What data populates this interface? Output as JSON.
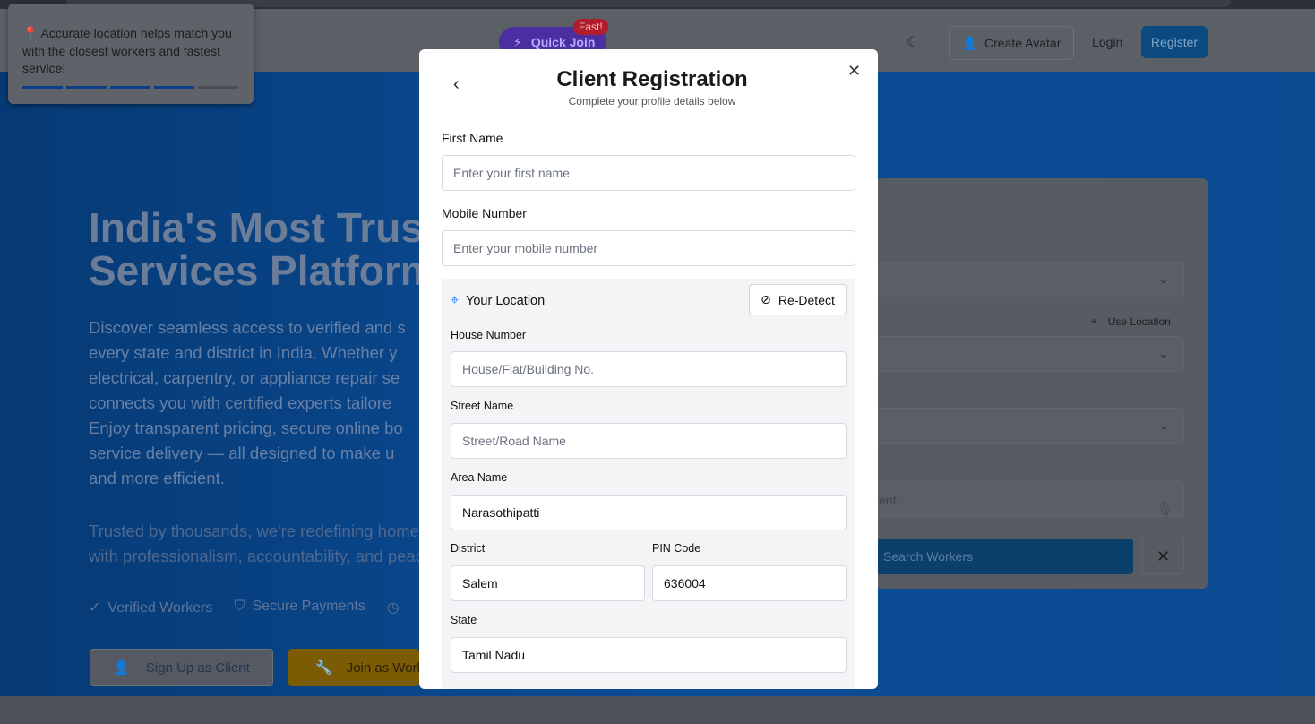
{
  "toast": {
    "text": "📍 Accurate location helps match you with the closest workers and fastest service!"
  },
  "navbar": {
    "quick_join": "Quick Join",
    "fast_badge": "Fast!",
    "create_avatar": "Create Avatar",
    "login": "Login",
    "register": "Register"
  },
  "hero": {
    "title": "India's Most Trust\nServices Platform",
    "title_line1": "India's Most Trust",
    "title_line2": "Services Platform",
    "desc_lines": [
      "Discover seamless access to verified and s",
      "every state and district in India. Whether y",
      "electrical, carpentry, or appliance repair se",
      "connects you with certified experts tailore",
      "Enjoy transparent pricing, secure online bo",
      "service delivery — all designed to make u",
      "and more efficient."
    ],
    "desc2_lines": [
      "Trusted by thousands, we're redefining home a",
      "with professionalism, accountability, and peace"
    ],
    "badges": [
      "Verified Workers",
      "Secure Payments"
    ],
    "signup_client": "Sign Up as Client",
    "join_worker": "Join as Worker"
  },
  "search_card": {
    "use_location": "Use Location",
    "input_placeholder": "ent...",
    "search_button": "Search Workers"
  },
  "modal": {
    "title": "Client Registration",
    "subtitle": "Complete your profile details below",
    "first_name_label": "First Name",
    "first_name_placeholder": "Enter your first name",
    "mobile_label": "Mobile Number",
    "mobile_placeholder": "Enter your mobile number",
    "location": {
      "title": "Your Location",
      "redetect": "Re-Detect",
      "house_label": "House Number",
      "house_placeholder": "House/Flat/Building No.",
      "street_label": "Street Name",
      "street_placeholder": "Street/Road Name",
      "area_label": "Area Name",
      "area_value": "Narasothipatti",
      "district_label": "District",
      "district_value": "Salem",
      "pin_label": "PIN Code",
      "pin_value": "636004",
      "state_label": "State",
      "state_value": "Tamil Nadu"
    }
  }
}
